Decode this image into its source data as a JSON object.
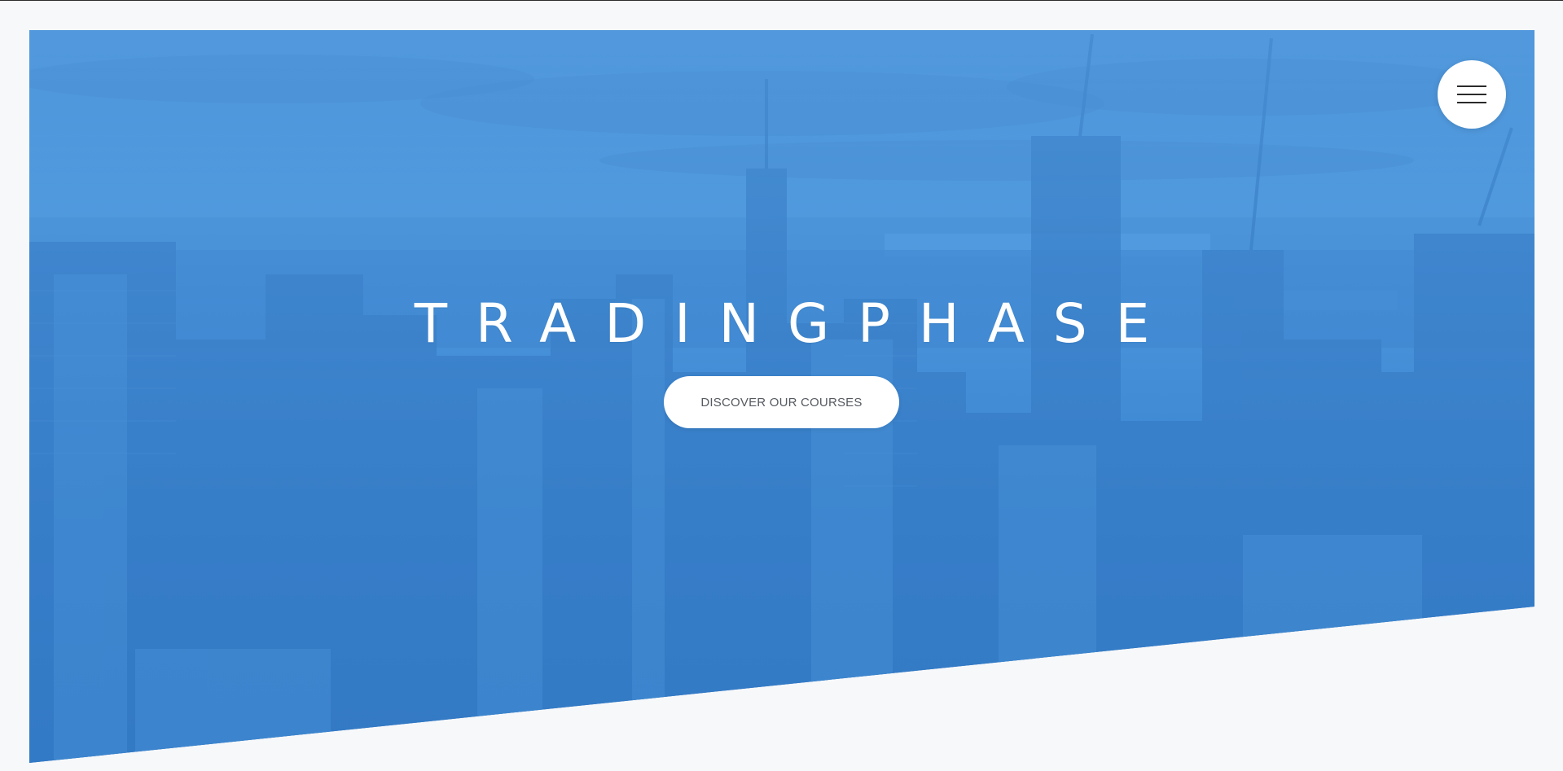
{
  "hero": {
    "title": "TRADINGPHASE",
    "cta_label": "DISCOVER OUR COURSES",
    "background_image": "city-skyline-photo",
    "overlay_color": "#3d8ad6"
  },
  "nav": {
    "menu_icon": "hamburger-menu-icon"
  },
  "colors": {
    "page_background": "#f7f8fa",
    "overlay_blue": "#3d8ad6",
    "button_text": "#555a60",
    "white": "#ffffff"
  }
}
